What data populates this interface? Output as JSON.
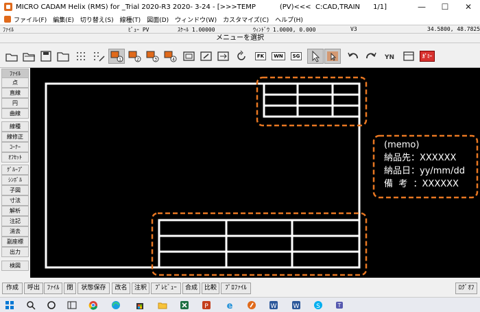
{
  "window": {
    "title": "MICRO CADAM Helix (RMS) for _Trial 2020-R3 2020- 3-24 - [>>>TEMP           (PV)<<<  C:CAD,TRAIN      1/1]",
    "controls": [
      "—",
      "☐",
      "✕"
    ]
  },
  "menubar": [
    "ファイル(F)",
    "編集(E)",
    "切り替え(S)",
    "線種(T)",
    "図面(D)",
    "ウィンドウ(W)",
    "カスタマイズ(C)",
    "ヘルプ(H)"
  ],
  "status": {
    "file_label": "ﾌｧｲﾙ",
    "view": "ﾋﾞｭｰ PV",
    "scale": "ｽｹｰﾙ 1.00000",
    "window": "ｳｨﾝﾄﾞｳ 1.0000, 0.000",
    "version": "V3",
    "coords": "34.5800,  48.7825"
  },
  "message": "メニューを選択",
  "toolbar": {
    "badges": [
      "1",
      "2",
      "3",
      "4"
    ],
    "text_buttons": [
      "FK",
      "WN",
      "SG"
    ],
    "gummy_label": "ｶﾞﾐｰ",
    "icons": [
      "new-icon",
      "open-icon",
      "save-icon",
      "folder-icon",
      "grid-icon",
      "grid-edit-icon",
      "select-1-icon",
      "select-2-icon",
      "select-3-icon",
      "select-4-icon",
      "frame-icon",
      "frame-edit-icon",
      "frame-arrow-icon",
      "rotate-icon",
      "fk-icon",
      "wn-icon",
      "sg-icon",
      "pointer-icon",
      "pointer-box-icon",
      "undo-icon",
      "redo-icon",
      "yn-icon",
      "box-icon",
      "gummy-icon"
    ]
  },
  "side_menu": [
    "ﾌｧｲﾙ",
    "点",
    "直線",
    "円",
    "曲線",
    "線種",
    "線修正",
    "ｺｰﾅｰ",
    "ｵﾌｾｯﾄ",
    "ｸﾞﾙｰﾌﾟ",
    "ｼﾝﾎﾞﾙ",
    "子図",
    "寸法",
    "解析",
    "注記",
    "消去",
    "副座標",
    "出力",
    "検図"
  ],
  "memo": {
    "heading": "(memo)",
    "lines": [
      "納品先：XXXXXX",
      "納品日：yy/mm/dd",
      "備  考  ：XXXXXX"
    ]
  },
  "bottom_buttons": [
    "作成",
    "呼出",
    "ﾌｧｲﾙ",
    "閉",
    "状態保存",
    "改名",
    "注釈",
    "ﾌﾟﾚﾋﾞｭｰ",
    "合成",
    "比較",
    "ﾌﾟﾛﾌｧｲﾙ"
  ],
  "logout_label": "ﾛｸﾞｵﾌ",
  "taskbar_icons": [
    "windows-start-icon",
    "search-icon",
    "task-view-icon",
    "widgets-icon",
    "chrome-icon",
    "edge-icon",
    "store-icon",
    "explorer-icon",
    "excel-icon",
    "powerpoint-icon",
    "ie-icon",
    "cadam-icon",
    "word-icon",
    "word-icon-2",
    "skype-icon",
    "teams-icon"
  ],
  "colors": {
    "canvas": "#000000",
    "drawing": "#ffffff",
    "highlight": "#e87722",
    "accent": "#e06a1b"
  }
}
